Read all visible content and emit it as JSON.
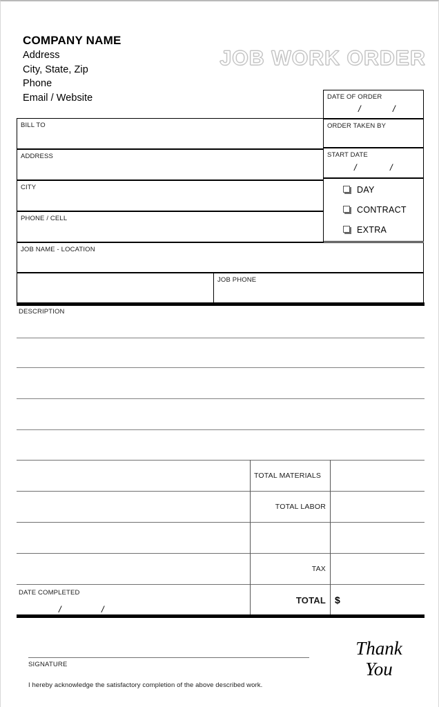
{
  "document": {
    "title": "JOB WORK ORDER"
  },
  "company": {
    "name": "COMPANY NAME",
    "lines": [
      "Address",
      "City, State, Zip",
      "Phone",
      "Email / Website"
    ]
  },
  "order_info": {
    "date_of_order": {
      "label": "DATE OF ORDER",
      "value": "",
      "separator_1": "/",
      "separator_2": "/"
    },
    "order_taken_by": {
      "label": "ORDER TAKEN BY",
      "value": ""
    },
    "start_date": {
      "label": "START DATE",
      "value": "",
      "separator_1": "/",
      "separator_2": "/"
    },
    "job_type_options": [
      {
        "label": "DAY",
        "checked": false
      },
      {
        "label": "CONTRACT",
        "checked": false
      },
      {
        "label": "EXTRA",
        "checked": false
      }
    ]
  },
  "customer": {
    "bill_to": {
      "label": "BILL TO",
      "value": ""
    },
    "address": {
      "label": "ADDRESS",
      "value": ""
    },
    "city": {
      "label": "CITY",
      "value": ""
    },
    "phone_cell": {
      "label": "PHONE / CELL",
      "value": ""
    },
    "job_name_location": {
      "label": "JOB NAME - LOCATION",
      "value": ""
    },
    "job_phone": {
      "label": "JOB PHONE",
      "value": ""
    }
  },
  "description": {
    "label": "DESCRIPTION",
    "lines": [
      "",
      "",
      "",
      ""
    ]
  },
  "totals": {
    "rows": [
      {
        "label": "TOTAL MATERIALS",
        "align": "left",
        "value": ""
      },
      {
        "label": "TOTAL LABOR",
        "align": "right",
        "value": ""
      },
      {
        "label": "",
        "align": "right",
        "value": ""
      },
      {
        "label": "TAX",
        "align": "right",
        "value": ""
      },
      {
        "label": "TOTAL",
        "align": "right",
        "value": "",
        "currency": "$"
      }
    ]
  },
  "completion": {
    "date_completed": {
      "label": "DATE COMPLETED",
      "value": "",
      "separator_1": "/",
      "separator_2": "/"
    }
  },
  "footer": {
    "signature_label": "SIGNATURE",
    "acknowledgement": "I hereby acknowledge the satisfactory completion of the above described work.",
    "thank_you_line_1": "Thank",
    "thank_you_line_2": "You"
  }
}
